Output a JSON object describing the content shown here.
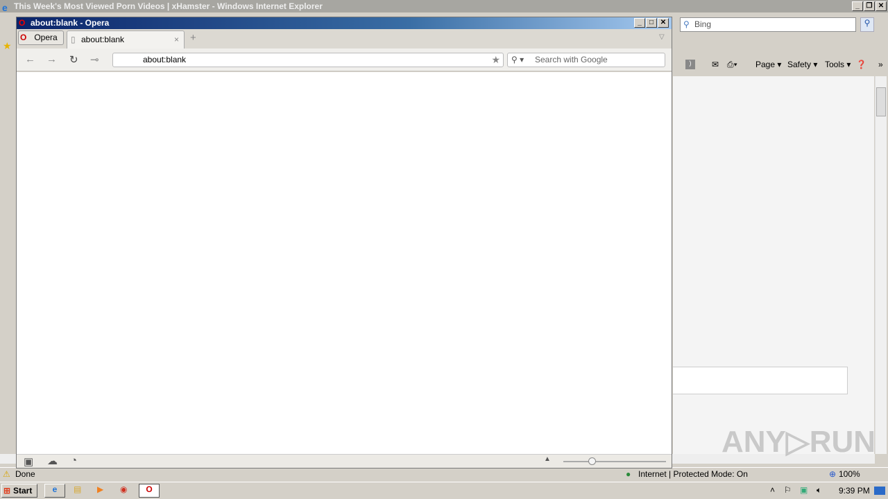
{
  "ie": {
    "title": "This Week's Most Viewed Porn Videos | xHamster - Windows Internet Explorer",
    "search_placeholder": "Bing",
    "toolbar": [
      "Page ▾",
      "Safety ▾",
      "Tools ▾"
    ],
    "status": "Done",
    "zone": "Internet | Protected Mode: On",
    "zoom": "100%"
  },
  "opera": {
    "title": "about:blank - Opera",
    "menu": "Opera",
    "tab": "about:blank",
    "address": "about:blank",
    "search_placeholder": "Search with Google"
  },
  "taskbar": {
    "start": "Start",
    "clock": "9:39 PM"
  },
  "watermark": "ANY▷RUN"
}
